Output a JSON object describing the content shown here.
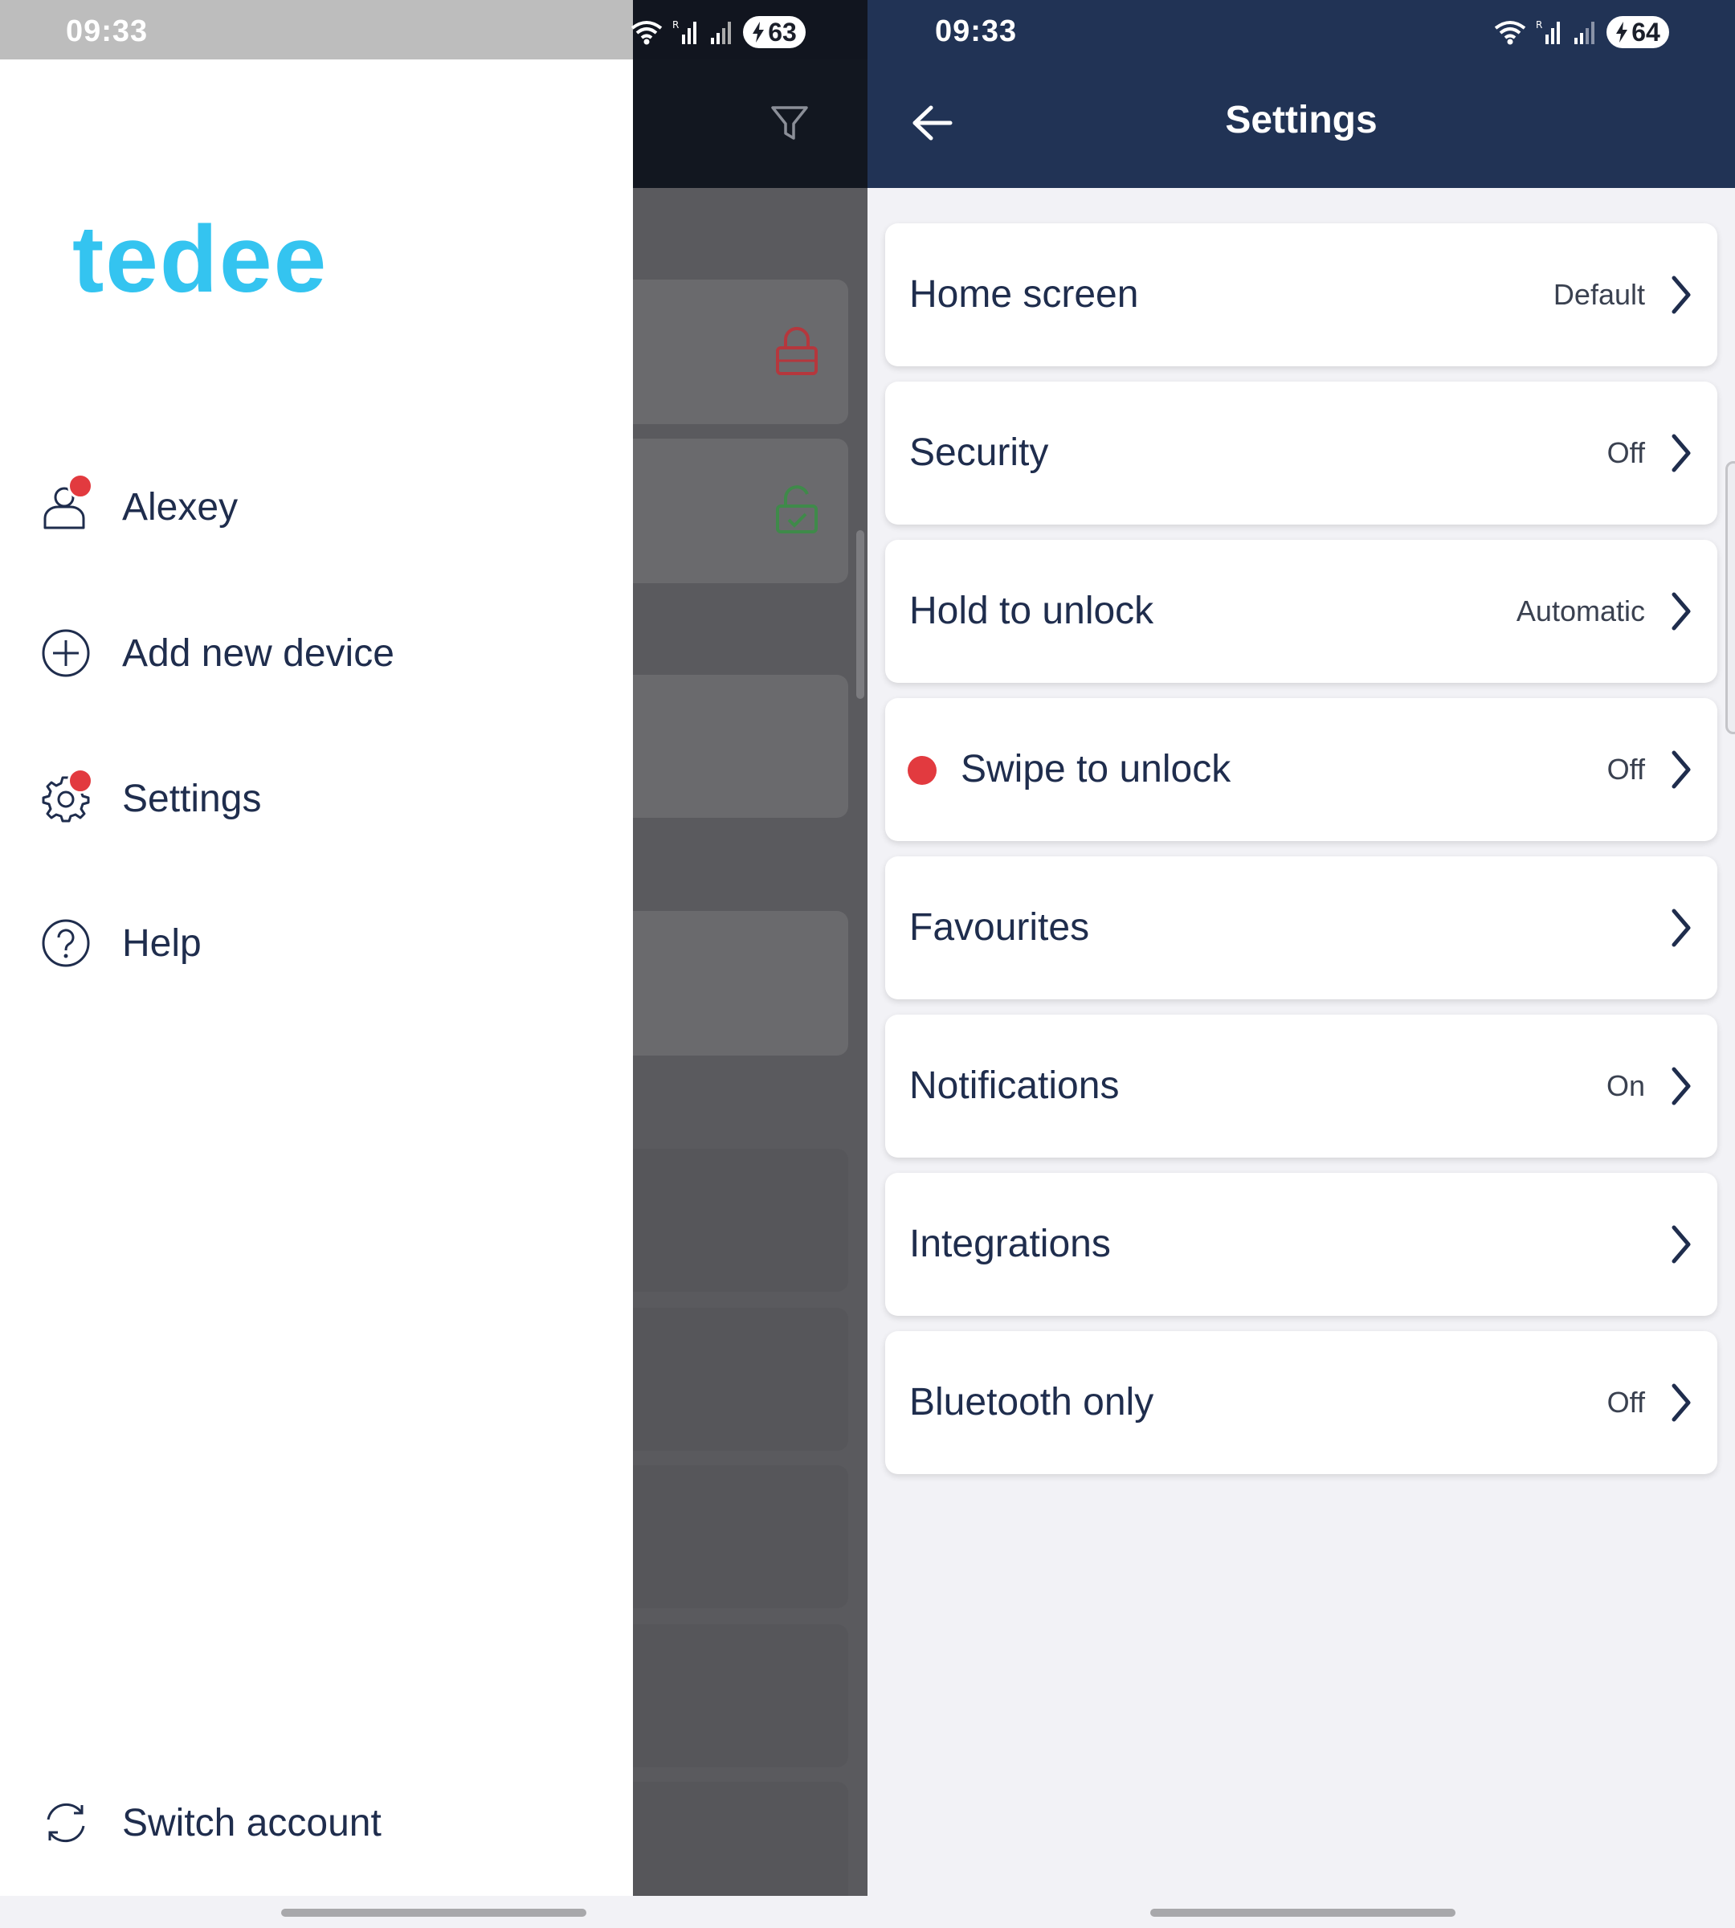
{
  "left_phone": {
    "status": {
      "time": "09:33",
      "battery": "63"
    },
    "drawer": {
      "logo": "tedee",
      "items": [
        {
          "label": "Alexey",
          "icon": "user-icon",
          "badge": true
        },
        {
          "label": "Add new device",
          "icon": "add-circle-icon",
          "badge": false
        },
        {
          "label": "Settings",
          "icon": "gear-icon",
          "badge": true
        },
        {
          "label": "Help",
          "icon": "help-icon",
          "badge": false
        }
      ],
      "footer": {
        "label": "Switch account",
        "icon": "switch-account-icon"
      }
    },
    "background_icons": [
      "filter-icon",
      "lock-closed-icon",
      "lock-open-check-icon"
    ]
  },
  "right_phone": {
    "status": {
      "time": "09:33",
      "battery": "64"
    },
    "header": {
      "title": "Settings",
      "back_icon": "arrow-back-icon"
    },
    "rows": [
      {
        "label": "Home screen",
        "value": "Default",
        "dot": false
      },
      {
        "label": "Security",
        "value": "Off",
        "dot": false
      },
      {
        "label": "Hold to unlock",
        "value": "Automatic",
        "dot": false
      },
      {
        "label": "Swipe to unlock",
        "value": "Off",
        "dot": true
      },
      {
        "label": "Favourites",
        "value": "",
        "dot": false
      },
      {
        "label": "Notifications",
        "value": "On",
        "dot": false
      },
      {
        "label": "Integrations",
        "value": "",
        "dot": false
      },
      {
        "label": "Bluetooth only",
        "value": "Off",
        "dot": false
      }
    ]
  },
  "colors": {
    "brand": "#34c4f0",
    "header": "#213355",
    "text": "#1f2d4d",
    "badge": "#e23a3f",
    "lock_red": "#b5373d",
    "lock_green": "#3f8a4a"
  }
}
